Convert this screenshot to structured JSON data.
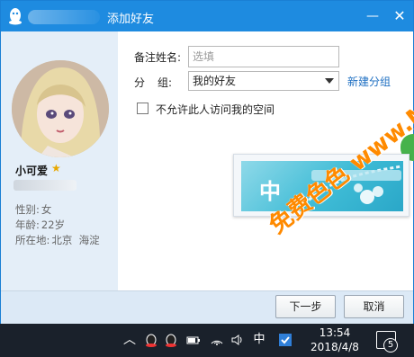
{
  "window": {
    "title": "添加好友",
    "accent_color": "#1e8be0"
  },
  "profile": {
    "name": "小可爱",
    "gender_label": "性别:",
    "gender": "女",
    "age_label": "年龄:",
    "age": "22岁",
    "location_label": "所在地:",
    "location": "北京  海淀"
  },
  "form": {
    "remark_label": "备注姓名:",
    "remark_placeholder": "选填",
    "group_label_1": "分",
    "group_label_2": "组:",
    "group_value": "我的好友",
    "new_group_link": "新建分组",
    "privacy_checkbox_label": "不允许此人访问我的空间"
  },
  "ime": {
    "mode_char": "中",
    "punct": "，。"
  },
  "buttons": {
    "next": "下一步",
    "cancel": "取消"
  },
  "taskbar": {
    "ime_indicator": "中",
    "time": "13:54",
    "date": "2018/4/8",
    "notification_count": "5"
  },
  "watermark": {
    "text": "免费色色 www.MFsese.com"
  }
}
